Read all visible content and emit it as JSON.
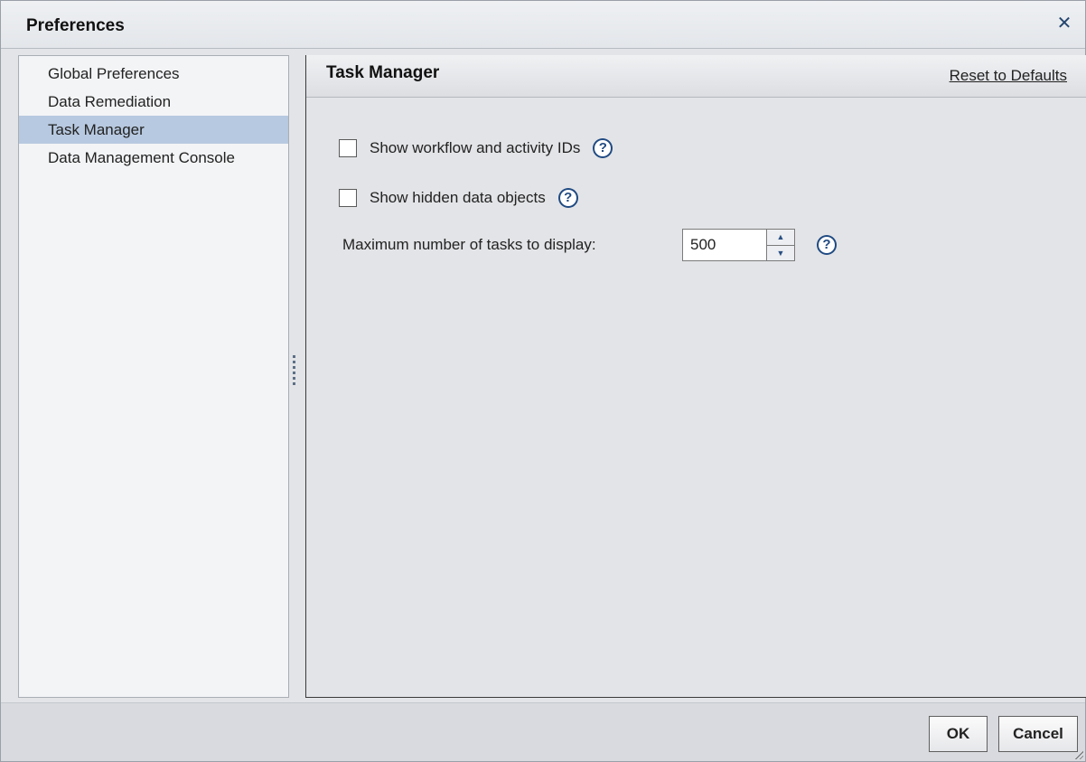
{
  "window": {
    "title": "Preferences",
    "close_icon": "close-icon",
    "close_glyph": "✕"
  },
  "sidebar": {
    "items": [
      {
        "label": "Global Preferences",
        "selected": false
      },
      {
        "label": "Data Remediation",
        "selected": false
      },
      {
        "label": "Task Manager",
        "selected": true
      },
      {
        "label": "Data Management Console",
        "selected": false
      }
    ]
  },
  "main": {
    "title": "Task Manager",
    "reset_label": "Reset to Defaults",
    "options": {
      "show_ids": {
        "label": "Show workflow and activity IDs",
        "checked": false
      },
      "show_hidden": {
        "label": "Show hidden data objects",
        "checked": false
      }
    },
    "max_tasks": {
      "label": "Maximum number of tasks to display:",
      "value": "500"
    },
    "help_glyph": "?"
  },
  "footer": {
    "ok_label": "OK",
    "cancel_label": "Cancel"
  },
  "colors": {
    "accent": "#1f4a82",
    "selected_row": "#b7c9e0"
  }
}
